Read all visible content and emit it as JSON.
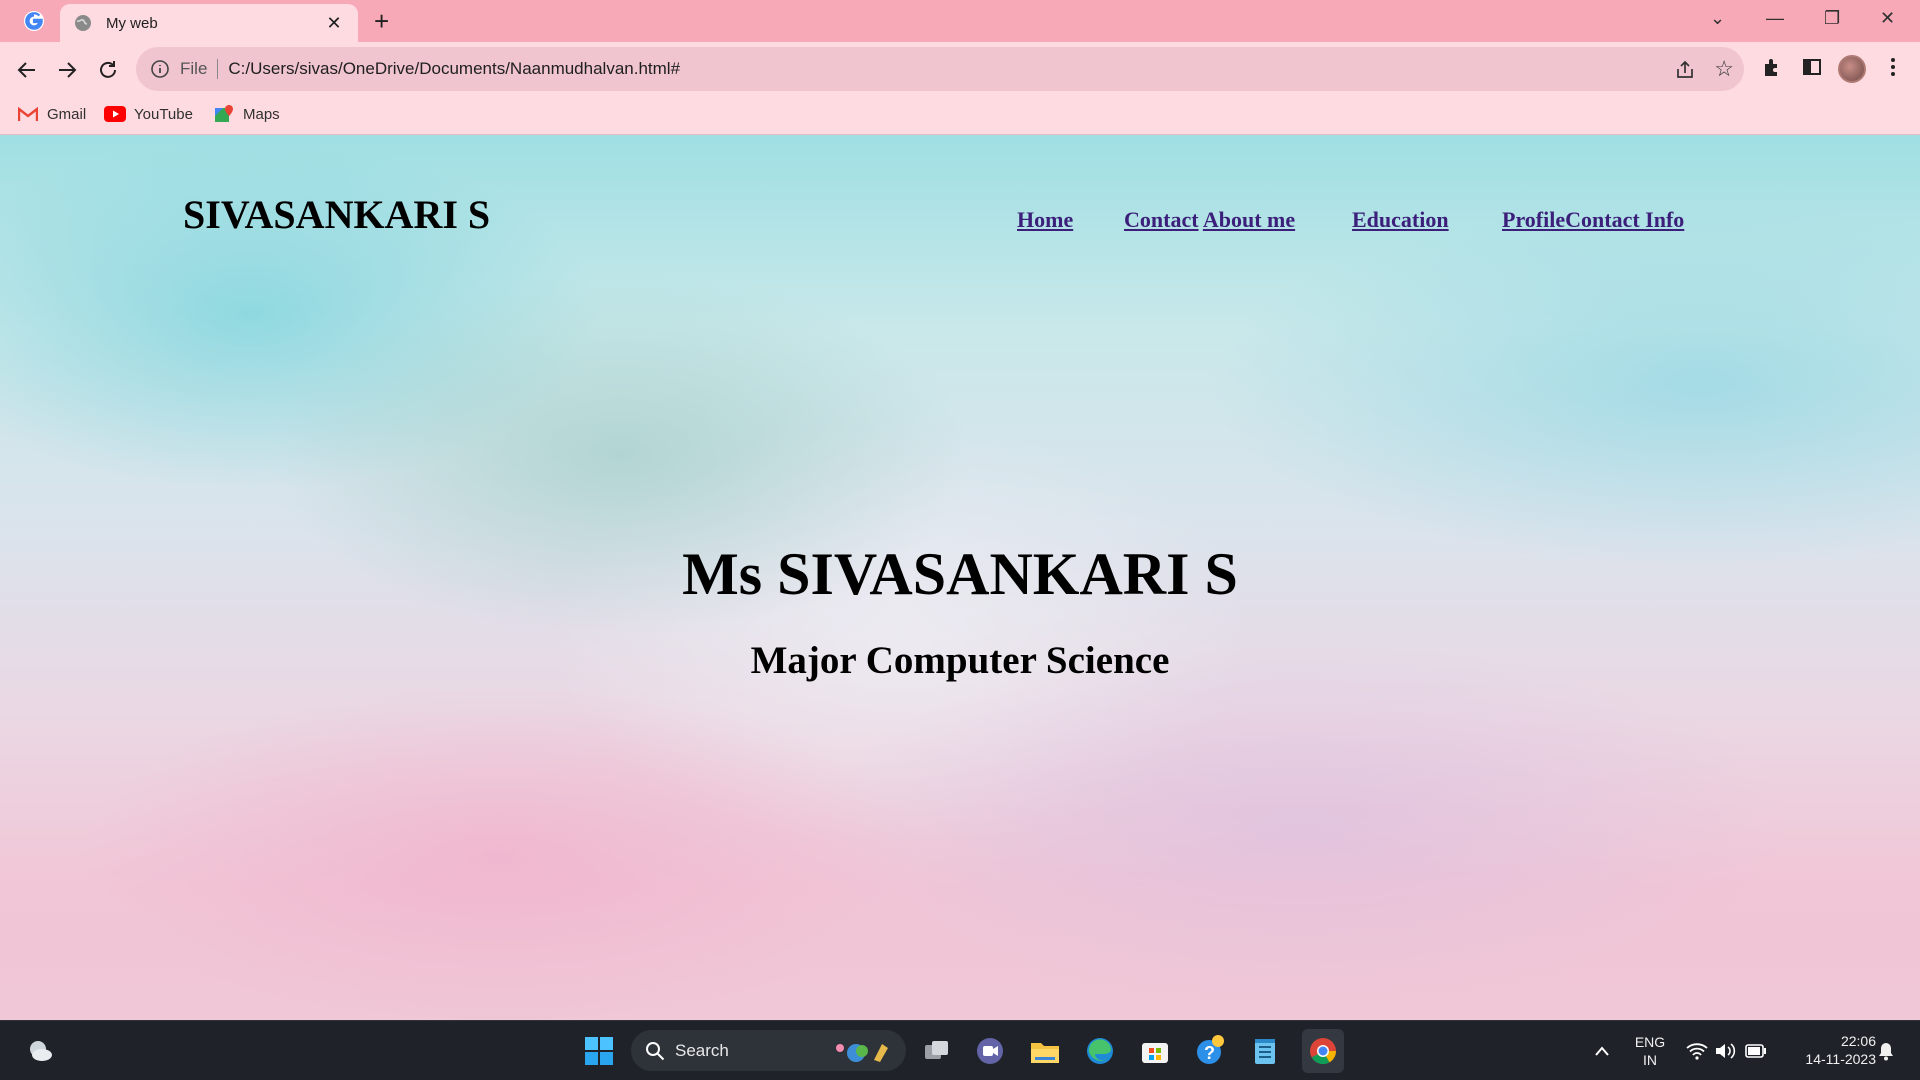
{
  "browser": {
    "tab": {
      "title": "My web",
      "close": "✕"
    },
    "new_tab": "+",
    "window_controls": {
      "tab_search": "⌄",
      "minimize": "—",
      "restore": "❐",
      "close": "✕"
    },
    "address": {
      "scheme": "File",
      "url": "C:/Users/sivas/OneDrive/Documents/Naanmudhalvan.html#"
    },
    "bookmarks": [
      {
        "label": "Gmail",
        "icon": "gmail-icon"
      },
      {
        "label": "YouTube",
        "icon": "youtube-icon"
      },
      {
        "label": "Maps",
        "icon": "maps-icon"
      }
    ]
  },
  "page": {
    "logo": "SIVASANKARI S",
    "nav": {
      "home": "Home",
      "contact": "Contact",
      "about": "About me",
      "education": "Education",
      "profile": "Profile",
      "contact_info": "Contact Info"
    },
    "hero_title": "Ms SIVASANKARI S",
    "hero_subtitle": "Major Computer Science",
    "link_color": "#3b1f7a"
  },
  "taskbar": {
    "search_label": "Search",
    "language": {
      "line1": "ENG",
      "line2": "IN"
    },
    "clock": {
      "time": "22:06",
      "date": "14-11-2023"
    }
  }
}
